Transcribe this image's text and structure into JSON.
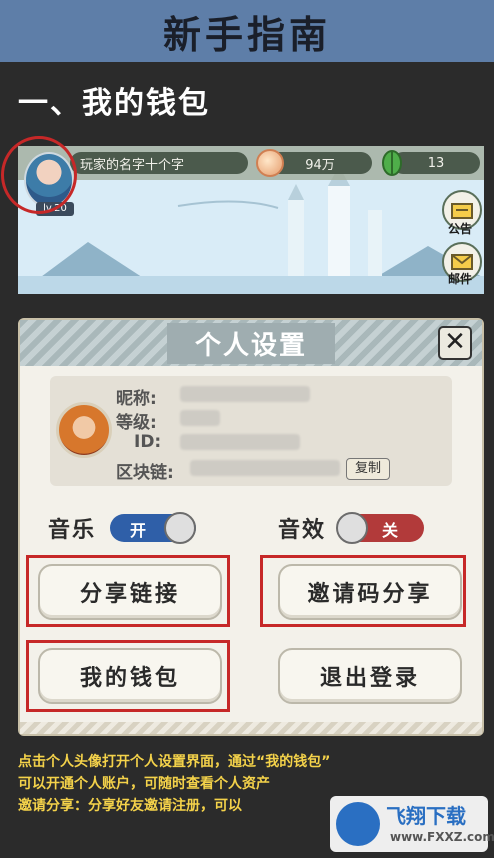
{
  "header": {
    "title": "新手指南"
  },
  "section": {
    "title": "一、我的钱包"
  },
  "game_hud": {
    "player_name": "玩家的名字十个字",
    "level": "lv.20",
    "gold": "94万",
    "gems": "13",
    "notice_label": "公告",
    "mail_label": "邮件"
  },
  "settings_panel": {
    "title": "个人设置",
    "close_glyph": "✕",
    "nickname_label": "昵称:",
    "level_label": "等级:",
    "id_label": "ID:",
    "chain_label": "区块链:",
    "copy_label": "复制",
    "music_label": "音乐",
    "music_state": "开",
    "sfx_label": "音效",
    "sfx_state": "关",
    "buttons": {
      "share_link": "分享链接",
      "invite_code_share": "邀请码分享",
      "my_wallet": "我的钱包",
      "logout": "退出登录"
    }
  },
  "caption": {
    "line1": "点击个人头像打开个人设置界面，通过“我的钱包”",
    "line2": "可以开通个人账户，可随时查看个人资产",
    "line3": "邀请分享：分享好友邀请注册，可以"
  },
  "watermark": {
    "name": "飞翔下载",
    "url": "www.FXXZ.com"
  },
  "colors": {
    "header_bg": "#5e7ea8",
    "highlight_red": "#c62828",
    "caption_yellow": "#f4d24a",
    "toggle_on": "#2f5fa8",
    "toggle_off": "#b23a3a"
  }
}
